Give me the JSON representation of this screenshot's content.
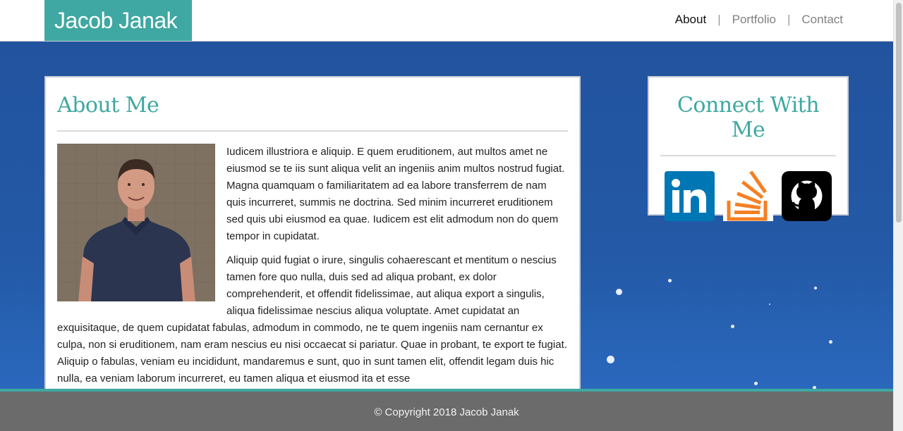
{
  "header": {
    "brand": "Jacob Janak",
    "nav": [
      {
        "label": "About",
        "active": true
      },
      {
        "label": "Portfolio",
        "active": false
      },
      {
        "label": "Contact",
        "active": false
      }
    ],
    "separator": "|"
  },
  "about": {
    "title": "About Me",
    "paragraphs": [
      "Iudicem illustriora e aliquip. E quem eruditionem, aut multos amet ne eiusmod se te iis sunt aliqua velit an ingeniis anim multos nostrud fugiat. Magna quamquam o familiaritatem ad ea labore transferrem de nam quis incurreret, summis ne doctrina. Sed minim incurreret eruditionem sed quis ubi eiusmod ea quae. Iudicem est elit admodum non do quem tempor in cupidatat.",
      "Aliquip quid fugiat o irure, singulis cohaerescant et mentitum o nescius tamen fore quo nulla, duis sed ad aliqua probant, ex dolor comprehenderit, et offendit fidelissimae, aut aliqua export a singulis, aliqua fidelissimae nescius aliqua voluptate. Amet cupidatat an exquisitaque, de quem cupidatat fabulas, admodum in commodo, ne te quem ingeniis nam cernantur ex culpa, non si eruditionem, nam eram nescius eu nisi occaecat si pariatur. Quae in probant, te export te fugiat. Aliquip o fabulas, veniam eu incididunt, mandaremus e sunt, quo in sunt tamen elit, offendit legam duis hic nulla, ea veniam laborum incurreret, eu tamen aliqua et eiusmod ita et esse"
    ]
  },
  "connect": {
    "title": "Connect With Me",
    "links": [
      {
        "name": "linkedin-icon",
        "label": "LinkedIn"
      },
      {
        "name": "stackoverflow-icon",
        "label": "Stack Overflow"
      },
      {
        "name": "github-icon",
        "label": "GitHub"
      }
    ]
  },
  "footer": {
    "copyright": "© Copyright 2018 Jacob Janak"
  },
  "colors": {
    "accent": "#3fa8a2",
    "background_blue": "#22539f",
    "footer": "#6b6b6b",
    "linkedin": "#0077b5",
    "stackoverflow": "#f48024",
    "github": "#000000"
  }
}
